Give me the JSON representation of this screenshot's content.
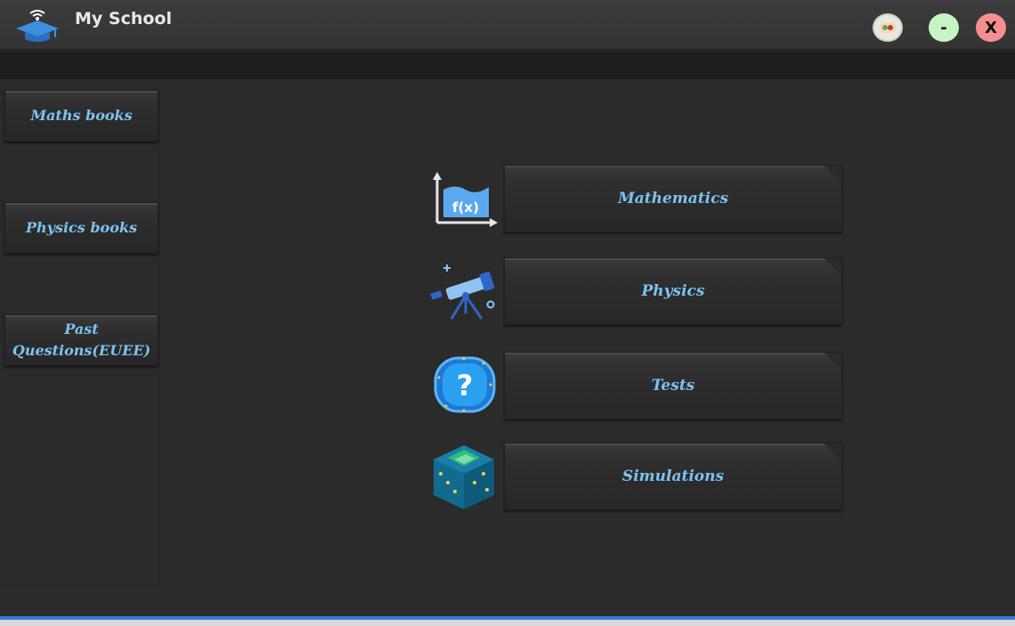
{
  "window": {
    "title": "My School",
    "logo_icon": "graduation-cap-wifi-icon",
    "controls": {
      "minimize_label": "-",
      "close_label": "X",
      "settings_icon": "app-badge-icon"
    }
  },
  "sidebar": {
    "items": [
      {
        "label": "Maths books"
      },
      {
        "label": "Physics books"
      },
      {
        "label": "Past Questions(EUEE)"
      }
    ]
  },
  "main": {
    "subjects": [
      {
        "label": "Mathematics",
        "icon": "function-graph-icon"
      },
      {
        "label": "Physics",
        "icon": "telescope-icon"
      },
      {
        "label": "Tests",
        "icon": "question-mark-icon"
      },
      {
        "label": "Simulations",
        "icon": "circuit-cube-icon"
      }
    ]
  },
  "colors": {
    "accent_text": "#7cc3ee",
    "background": "#2b2b2b",
    "minimize": "#c6f5c4",
    "close": "#f58f8f"
  }
}
